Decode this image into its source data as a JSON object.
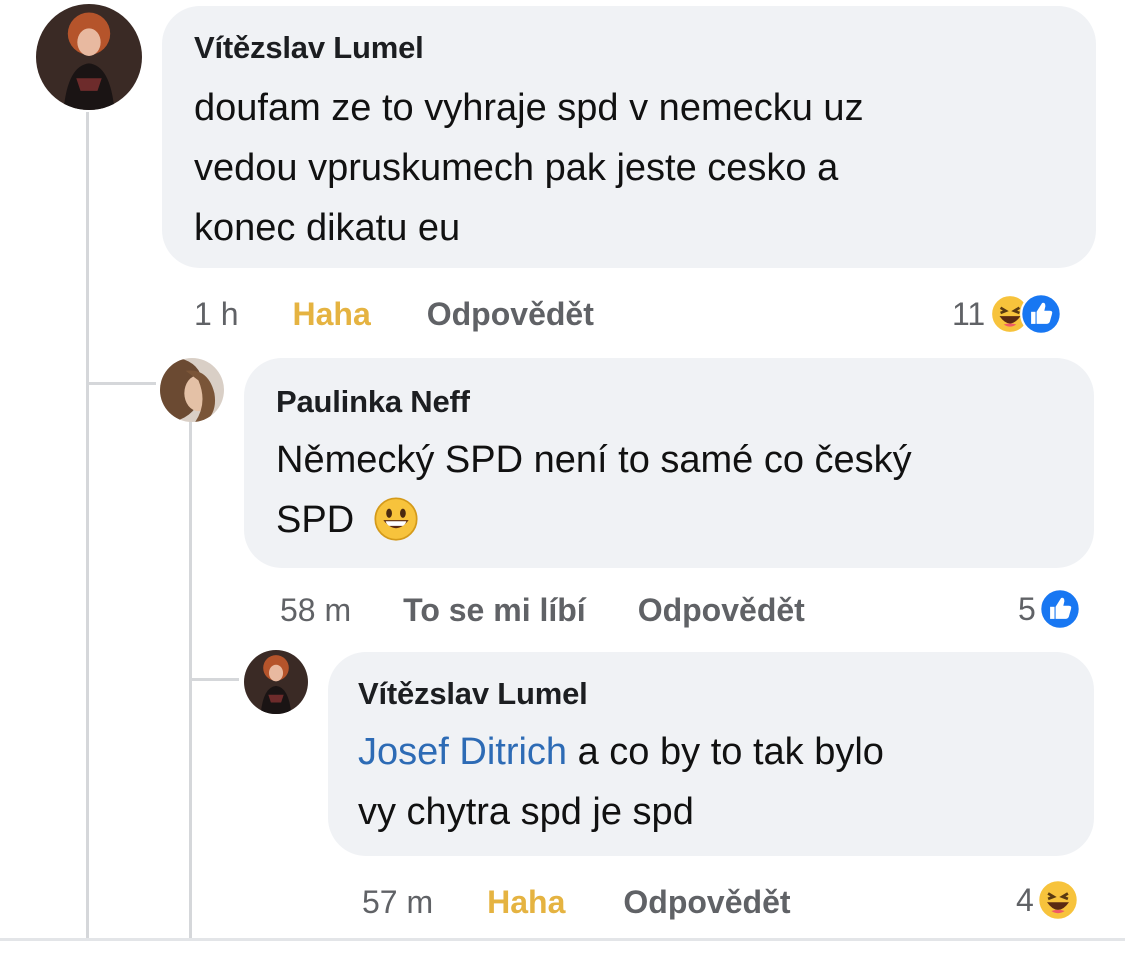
{
  "comments": [
    {
      "author": "Vítězslav Lumel",
      "lines": [
        "doufam ze to vyhraje spd v nemecku uz",
        "vedou vpruskumech pak jeste cesko a",
        "konec dikatu eu"
      ],
      "time": "1 h",
      "reaction_label": "Haha",
      "reply_label": "Odpovědět",
      "reaction_count": "11",
      "reaction_icons": [
        "haha-emoji",
        "like-emoji"
      ]
    },
    {
      "author": "Paulinka Neff",
      "lines": [
        "Německý SPD není to samé co český",
        "SPD"
      ],
      "inline_emoji": "smiley-emoji",
      "time": "58 m",
      "reaction_label": "To se mi líbí",
      "reply_label": "Odpovědět",
      "reaction_count": "5",
      "reaction_icons": [
        "like-emoji"
      ]
    },
    {
      "author": "Vítězslav Lumel",
      "mention": "Josef Ditrich",
      "lines": [
        " a co by to tak bylo",
        "vy chytra spd je spd"
      ],
      "time": "57 m",
      "reaction_label": "Haha",
      "reply_label": "Odpovědět",
      "reaction_count": "4",
      "reaction_icons": [
        "haha-emoji"
      ]
    }
  ],
  "colors": {
    "bubble": "#f0f2f5",
    "haha": "#e5b341",
    "mention": "#2d6bb5",
    "like": "#1877f2"
  }
}
